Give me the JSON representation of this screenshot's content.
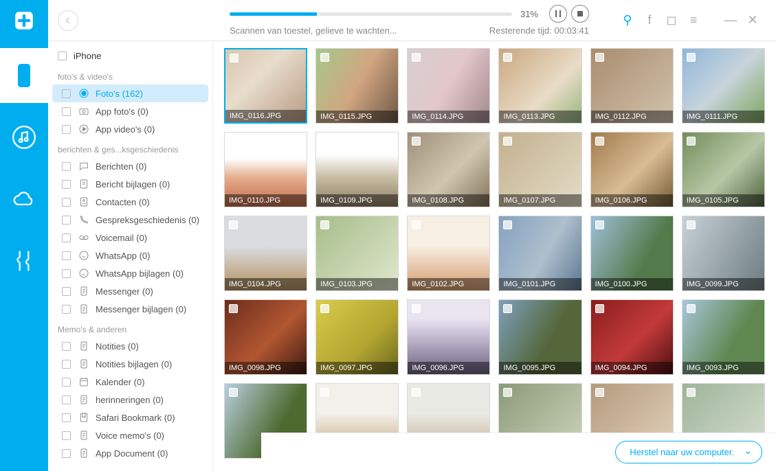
{
  "progress": {
    "percent_label": "31%",
    "percent_value": 31,
    "status_text": "Scannen van toestel, gelieve te wachten...",
    "remaining_label": "Resterende tijd: 00:03:41"
  },
  "device_label": "iPhone",
  "groups": [
    {
      "title": "foto's & video's",
      "items": [
        {
          "label": "Foto's (162)",
          "selected": true,
          "icon": "photos"
        },
        {
          "label": "App foto's (0)",
          "icon": "camera"
        },
        {
          "label": "App video's (0)",
          "icon": "play"
        }
      ]
    },
    {
      "title": "berichten & ges...ksgeschiedenis",
      "items": [
        {
          "label": "Berichten (0)",
          "icon": "msg"
        },
        {
          "label": "Bericht bijlagen (0)",
          "icon": "attach"
        },
        {
          "label": "Contacten (0)",
          "icon": "contact"
        },
        {
          "label": "Gespreksgeschiedenis (0)",
          "icon": "callhist"
        },
        {
          "label": "Voicemail (0)",
          "icon": "voicemail"
        },
        {
          "label": "WhatsApp (0)",
          "icon": "whatsapp"
        },
        {
          "label": "WhatsApp bijlagen (0)",
          "icon": "whatsapp"
        },
        {
          "label": "Messenger (0)",
          "icon": "doc"
        },
        {
          "label": "Messenger bijlagen (0)",
          "icon": "doc"
        }
      ]
    },
    {
      "title": "Memo's & anderen",
      "items": [
        {
          "label": "Notities (0)",
          "icon": "doc"
        },
        {
          "label": "Notities bijlagen (0)",
          "icon": "doc"
        },
        {
          "label": "Kalender (0)",
          "icon": "cal"
        },
        {
          "label": "herinneringen (0)",
          "icon": "doc"
        },
        {
          "label": "Safari Bookmark (0)",
          "icon": "bookmark"
        },
        {
          "label": "Voice memo's (0)",
          "icon": "doc"
        },
        {
          "label": "App Document (0)",
          "icon": "doc"
        }
      ]
    }
  ],
  "thumbs": [
    {
      "cap": "IMG_0116.JPG",
      "sel": true,
      "cls": "p1"
    },
    {
      "cap": "IMG_0115.JPG",
      "cls": "p2"
    },
    {
      "cap": "IMG_0114.JPG",
      "cls": "p3"
    },
    {
      "cap": "IMG_0113.JPG",
      "cls": "p4"
    },
    {
      "cap": "IMG_0112.JPG",
      "cls": "p5"
    },
    {
      "cap": "IMG_0111.JPG",
      "cls": "p6"
    },
    {
      "cap": "IMG_0110.JPG",
      "cls": "p7"
    },
    {
      "cap": "IMG_0109.JPG",
      "cls": "p8"
    },
    {
      "cap": "IMG_0108.JPG",
      "cls": "p9"
    },
    {
      "cap": "IMG_0107.JPG",
      "cls": "p10"
    },
    {
      "cap": "IMG_0106.JPG",
      "cls": "p11"
    },
    {
      "cap": "IMG_0105.JPG",
      "cls": "p12"
    },
    {
      "cap": "IMG_0104.JPG",
      "cls": "p13"
    },
    {
      "cap": "IMG_0103.JPG",
      "cls": "p14"
    },
    {
      "cap": "IMG_0102.JPG",
      "cls": "p15"
    },
    {
      "cap": "IMG_0101.JPG",
      "cls": "p16"
    },
    {
      "cap": "IMG_0100.JPG",
      "cls": "p17"
    },
    {
      "cap": "IMG_0099.JPG",
      "cls": "p18"
    },
    {
      "cap": "IMG_0098.JPG",
      "cls": "p19"
    },
    {
      "cap": "IMG_0097.JPG",
      "cls": "p20"
    },
    {
      "cap": "IMG_0096.JPG",
      "cls": "p21"
    },
    {
      "cap": "IMG_0095.JPG",
      "cls": "p22"
    },
    {
      "cap": "IMG_0094.JPG",
      "cls": "p23"
    },
    {
      "cap": "IMG_0093.JPG",
      "cls": "p24"
    },
    {
      "cap": "",
      "cls": "p25"
    },
    {
      "cap": "",
      "cls": "p26"
    },
    {
      "cap": "",
      "cls": "p27"
    },
    {
      "cap": "",
      "cls": "p28"
    },
    {
      "cap": "",
      "cls": "p29"
    },
    {
      "cap": "",
      "cls": "p30"
    }
  ],
  "recover_label": "Herstel naar uw computer."
}
